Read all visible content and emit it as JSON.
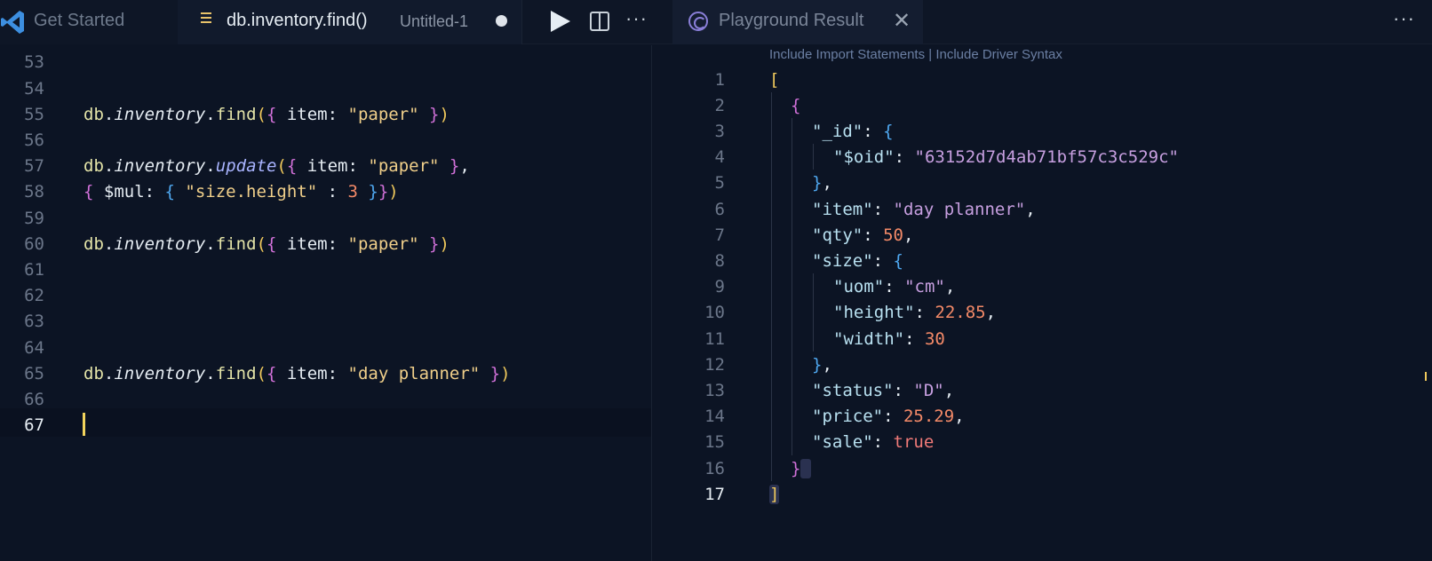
{
  "tabs": {
    "get_started": "Get Started",
    "editor_tab": "db.inventory.find()",
    "editor_tab_desc": "Untitled-1",
    "result_tab": "Playground Result"
  },
  "icons": [
    "vscode-logo-icon",
    "file-list-icon",
    "run-icon",
    "split-editor-icon",
    "more-actions-icon",
    "playground-result-icon",
    "close-icon"
  ],
  "colors": {
    "background": "#0c1424",
    "string": "#f0cf8a",
    "number": "#f48a68",
    "cursor": "#f2d45c"
  },
  "left_editor": {
    "line_numbers": [
      "53",
      "54",
      "55",
      "56",
      "57",
      "58",
      "59",
      "60",
      "61",
      "62",
      "63",
      "64",
      "65",
      "66",
      "67"
    ],
    "active_line": "67",
    "code": {
      "l55": {
        "db": "db",
        "dot1": ".",
        "coll": "inventory",
        "dot2": ".",
        "fn": "find",
        "p1": "(",
        "b1": "{",
        "key": " item: ",
        "str": "\"paper\"",
        "b2": " }",
        "p2": ")"
      },
      "l57": {
        "db": "db",
        "dot1": ".",
        "coll": "inventory",
        "dot2": ".",
        "fn": "update",
        "p1": "(",
        "b1": "{",
        "key": " item: ",
        "str": "\"paper\"",
        "b2": " }",
        "tail": ","
      },
      "l58": {
        "b1": "{",
        "key": " $mul: ",
        "b2": "{",
        "str": " \"size.height\"",
        "sep": " : ",
        "num": "3",
        "b3": " }",
        "b4": "}",
        "p2": ")"
      },
      "l60": {
        "db": "db",
        "dot1": ".",
        "coll": "inventory",
        "dot2": ".",
        "fn": "find",
        "p1": "(",
        "b1": "{",
        "key": " item: ",
        "str": "\"paper\"",
        "b2": " }",
        "p2": ")"
      },
      "l65": {
        "db": "db",
        "dot1": ".",
        "coll": "inventory",
        "dot2": ".",
        "fn": "find",
        "p1": "(",
        "b1": "{",
        "key": " item: ",
        "str": "\"day planner\"",
        "b2": " }",
        "p2": ")"
      }
    }
  },
  "right_editor": {
    "actions": "Include Import Statements | Include Driver Syntax",
    "line_numbers": [
      "1",
      "2",
      "3",
      "4",
      "5",
      "6",
      "7",
      "8",
      "9",
      "10",
      "11",
      "12",
      "13",
      "14",
      "15",
      "16",
      "17"
    ],
    "active_line": "17",
    "json": {
      "open_arr": "[",
      "open_obj": "{",
      "id_key": "\"_id\"",
      "id_colon": ": ",
      "id_open": "{",
      "oid_key": "\"$oid\"",
      "oid_colon": ": ",
      "oid_val": "\"63152d7d4ab71bf57c3c529c\"",
      "id_close": "}",
      "id_comma": ",",
      "item_key": "\"item\"",
      "item_colon": ": ",
      "item_val": "\"day planner\"",
      "item_comma": ",",
      "qty_key": "\"qty\"",
      "qty_colon": ": ",
      "qty_val": "50",
      "qty_comma": ",",
      "size_key": "\"size\"",
      "size_colon": ": ",
      "size_open": "{",
      "uom_key": "\"uom\"",
      "uom_colon": ": ",
      "uom_val": "\"cm\"",
      "uom_comma": ",",
      "height_key": "\"height\"",
      "height_colon": ": ",
      "height_val": "22.85",
      "height_comma": ",",
      "width_key": "\"width\"",
      "width_colon": ": ",
      "width_val": "30",
      "size_close": "}",
      "size_comma": ",",
      "status_key": "\"status\"",
      "status_colon": ": ",
      "status_val": "\"D\"",
      "status_comma": ",",
      "price_key": "\"price\"",
      "price_colon": ": ",
      "price_val": "25.29",
      "price_comma": ",",
      "sale_key": "\"sale\"",
      "sale_colon": ": ",
      "sale_val": "true",
      "close_obj": "}",
      "close_arr": "]"
    }
  }
}
